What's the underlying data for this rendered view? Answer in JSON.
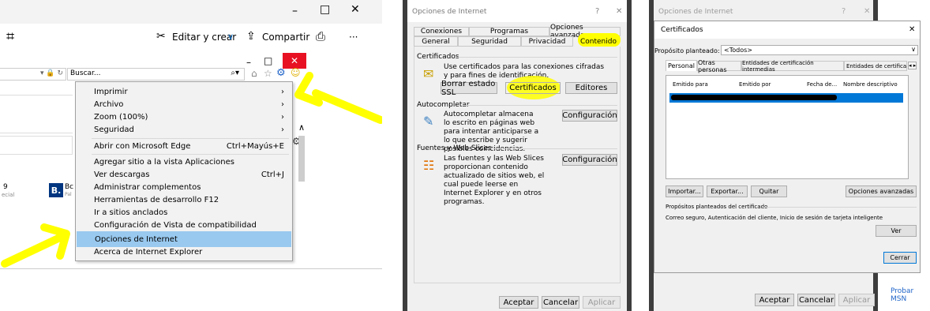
{
  "browser": {
    "markup_label": "Editar y crear",
    "share_label": "Compartir",
    "more_label": "···",
    "search_placeholder": "Buscar...",
    "address_suffix": "▾ 🔒 ↻",
    "min": "–",
    "max": "□",
    "close": "✕"
  },
  "menu": {
    "items": [
      {
        "label": "Imprimir",
        "shortcut": "›"
      },
      {
        "label": "Archivo",
        "shortcut": "›"
      },
      {
        "label": "Zoom (100%)",
        "shortcut": "›"
      },
      {
        "label": "Seguridad",
        "shortcut": "›"
      },
      {
        "label": "Abrir con Microsoft Edge",
        "shortcut": "Ctrl+Mayús+E"
      },
      {
        "label": "Agregar sitio a la vista Aplicaciones",
        "shortcut": ""
      },
      {
        "label": "Ver descargas",
        "shortcut": "Ctrl+J"
      },
      {
        "label": "Administrar complementos",
        "shortcut": ""
      },
      {
        "label": "Herramientas de desarrollo F12",
        "shortcut": ""
      },
      {
        "label": "Ir a sitios anclados",
        "shortcut": ""
      },
      {
        "label": "Configuración de Vista de compatibilidad",
        "shortcut": ""
      },
      {
        "label": "Opciones de Internet",
        "shortcut": ""
      },
      {
        "label": "Acerca de Internet Explorer",
        "shortcut": ""
      }
    ]
  },
  "bg_fragments": {
    "b_logo": "B.",
    "bc": "Bc",
    "pal": "Pal",
    "nine": "9",
    "ecial": "ecial"
  },
  "options": {
    "title": "Opciones de Internet",
    "help": "?",
    "close": "✕",
    "tabs_top": [
      "Conexiones",
      "Programas",
      "Opciones avanzadas"
    ],
    "tabs_bottom": [
      "General",
      "Seguridad",
      "Privacidad",
      "Contenido"
    ],
    "cert_group": "Certificados",
    "cert_text": "Use certificados para las conexiones cifradas y para fines de identificación.",
    "btn_clear_ssl": "Borrar estado SSL",
    "btn_certs": "Certificados",
    "btn_publishers": "Editores",
    "auto_group": "Autocompletar",
    "auto_text": "Autocompletar almacena lo escrito en páginas web para intentar anticiparse a lo que escribe y sugerir posibles coincidencias.",
    "btn_auto_config": "Configuración",
    "feeds_group": "Fuentes y Web Slices",
    "feeds_text": "Las fuentes y las Web Slices proporcionan contenido actualizado de sitios web, el cual puede leerse en Internet Explorer y en otros programas.",
    "btn_feeds_config": "Configuración",
    "btn_ok": "Aceptar",
    "btn_cancel": "Cancelar",
    "btn_apply": "Aplicar"
  },
  "certs": {
    "behind_title": "Opciones de Internet",
    "behind_help": "?",
    "behind_close": "✕",
    "title": "Certificados",
    "close": "✕",
    "purpose_label": "Propósito planteado:",
    "purpose_value": "<Todos>",
    "tabs": [
      "Personal",
      "Otras personas",
      "Entidades de certificación intermedias",
      "Entidades de certificaci"
    ],
    "tab_scroll": "◂ ▸",
    "columns": [
      "Emitido para",
      "Emitido por",
      "Fecha de...",
      "Nombre descriptivo"
    ],
    "btn_import": "Importar...",
    "btn_export": "Exportar...",
    "btn_remove": "Quitar",
    "btn_advanced": "Opciones avanzadas",
    "purposes_group": "Propósitos planteados del certificado",
    "purposes_text": "Correo seguro, Autenticación del cliente, Inicio de sesión de tarjeta inteligente",
    "btn_view": "Ver",
    "btn_close": "Cerrar",
    "btn_ok": "Aceptar",
    "btn_cancel": "Cancelar",
    "btn_apply": "Aplicar",
    "probar": "Probar MSN"
  },
  "colors": {
    "highlight_yellow": "#ffff00",
    "menu_selected": "#99c9ef",
    "close_red": "#e81123",
    "row_selected": "#0078d7"
  }
}
